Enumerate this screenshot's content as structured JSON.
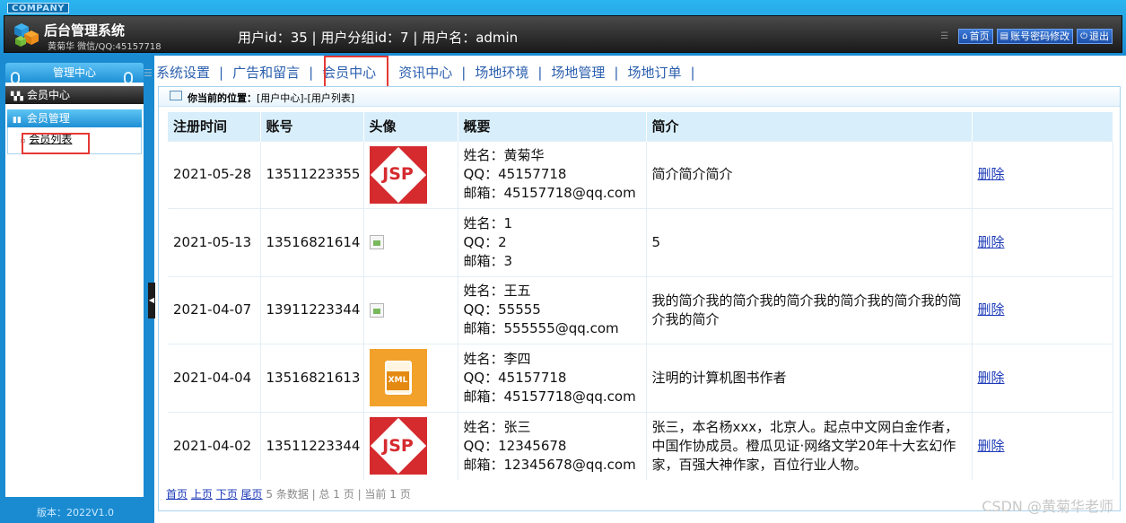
{
  "header": {
    "company": "COMPANY",
    "title": "后台管理系统",
    "subtitle": "黄菊华 微信/QQ:45157718",
    "user_info": "用户id：35 | 用户分组id：7 | 用户名：admin",
    "links": [
      {
        "icon": "home-icon",
        "label": "首页"
      },
      {
        "icon": "document-icon",
        "label": "账号密码修改"
      },
      {
        "icon": "power-icon",
        "label": "退出"
      }
    ]
  },
  "sidebar": {
    "heading": "管理中心",
    "category": "会员中心",
    "group": "会员管理",
    "item": "会员列表",
    "version": "版本：2022V1.0"
  },
  "nav": {
    "items": [
      "系统设置",
      "广告和留言",
      "会员中心",
      "资讯中心",
      "场地环境",
      "场地管理",
      "场地订单"
    ],
    "separator": "|",
    "active": "会员中心"
  },
  "breadcrumb": {
    "label": "你当前的位置：",
    "path": "[用户中心]-[用户列表]"
  },
  "table": {
    "headers": [
      "注册时间",
      "账号",
      "头像",
      "概要",
      "简介",
      ""
    ],
    "rows": [
      {
        "date": "2021-05-28",
        "account": "13511223355",
        "avatar": "jsp-icon",
        "name": "姓名：黄菊华",
        "qq": "QQ：45157718",
        "email": "邮箱：45157718@qq.com",
        "intro": "简介简介简介",
        "action": "删除"
      },
      {
        "date": "2021-05-13",
        "account": "13516821614",
        "avatar": "broken-image-icon",
        "name": "姓名：1",
        "qq": "QQ：2",
        "email": "邮箱：3",
        "intro": "5",
        "action": "删除"
      },
      {
        "date": "2021-04-07",
        "account": "13911223344",
        "avatar": "broken-image-icon",
        "name": "姓名：王五",
        "qq": "QQ：55555",
        "email": "邮箱：555555@qq.com",
        "intro": "我的简介我的简介我的简介我的简介我的简介我的简介我的简介",
        "action": "删除"
      },
      {
        "date": "2021-04-04",
        "account": "13516821613",
        "avatar": "xml-icon",
        "name": "姓名：李四",
        "qq": "QQ：45157718",
        "email": "邮箱：45157718@qq.com",
        "intro": "注明的计算机图书作者",
        "action": "删除"
      },
      {
        "date": "2021-04-02",
        "account": "13511223344",
        "avatar": "jsp-icon",
        "name": "姓名：张三",
        "qq": "QQ：12345678",
        "email": "邮箱：12345678@qq.com",
        "intro": "张三，本名杨xxx，北京人。起点中文网白金作者，中国作协成员。橙瓜见证·网络文学20年十大玄幻作家，百强大神作家，百位行业人物。",
        "action": "删除"
      }
    ]
  },
  "pager": {
    "first": "首页",
    "prev": "上页",
    "next": "下页",
    "last": "尾页",
    "summary": "5 条数据 | 总 1 页 | 当前 1 页"
  },
  "watermark": "CSDN @黄菊华老师",
  "colors": {
    "accent": "#1a8bd1",
    "highlight_box": "#e53935",
    "link": "#1b39b8",
    "nav_text": "#2b5fae"
  }
}
